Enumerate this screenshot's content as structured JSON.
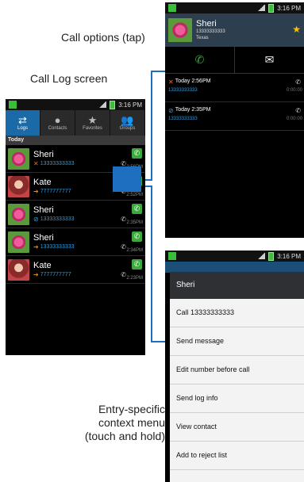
{
  "captions": {
    "call_options": "Call options (tap)",
    "call_log_screen": "Call Log screen",
    "context_menu": [
      "Entry-specific",
      "context menu",
      "(touch and hold)"
    ]
  },
  "status_bar": {
    "time": "3:16 PM"
  },
  "call_log": {
    "tabs": [
      {
        "label": "Logs",
        "icon": "arrows-icon",
        "active": true
      },
      {
        "label": "Contacts",
        "icon": "person-icon",
        "active": false
      },
      {
        "label": "Favorites",
        "icon": "star-icon",
        "active": false
      },
      {
        "label": "Groups",
        "icon": "group-icon",
        "active": false
      }
    ],
    "section_label": "Today",
    "rows": [
      {
        "name": "Sheri",
        "number": "13333333333",
        "type": "missed",
        "time": "2:56PM"
      },
      {
        "name": "Kate",
        "number": "7777777777",
        "type": "outgoing",
        "time": "2:52PM"
      },
      {
        "name": "Sheri",
        "number": "13333333333",
        "type": "rejected",
        "time": "2:35PM"
      },
      {
        "name": "Sheri",
        "number": "13333333333",
        "type": "outgoing",
        "time": "2:34PM"
      },
      {
        "name": "Kate",
        "number": "7777777777",
        "type": "outgoing",
        "time": "2:23PM"
      }
    ]
  },
  "call_options": {
    "contact_name": "Sheri",
    "contact_number": "13333333333",
    "contact_location": "Texas",
    "entries": [
      {
        "time": "Today 2:56PM",
        "number": "13333333333",
        "duration": "0:00:00",
        "type": "missed"
      },
      {
        "time": "Today 2:35PM",
        "number": "13333333333",
        "duration": "0:00:00",
        "type": "rejected"
      }
    ]
  },
  "context_menu": {
    "title": "Sheri",
    "items": [
      "Call 13333333333",
      "Send message",
      "Edit number before call",
      "Send log info",
      "View contact",
      "Add to reject list"
    ]
  },
  "colors": {
    "accent_blue": "#1f6fc0",
    "tab_active": "#1b6aa8",
    "call_green": "#3da83d",
    "missed_orange": "#e86a1e",
    "star_yellow": "#f5c400"
  }
}
